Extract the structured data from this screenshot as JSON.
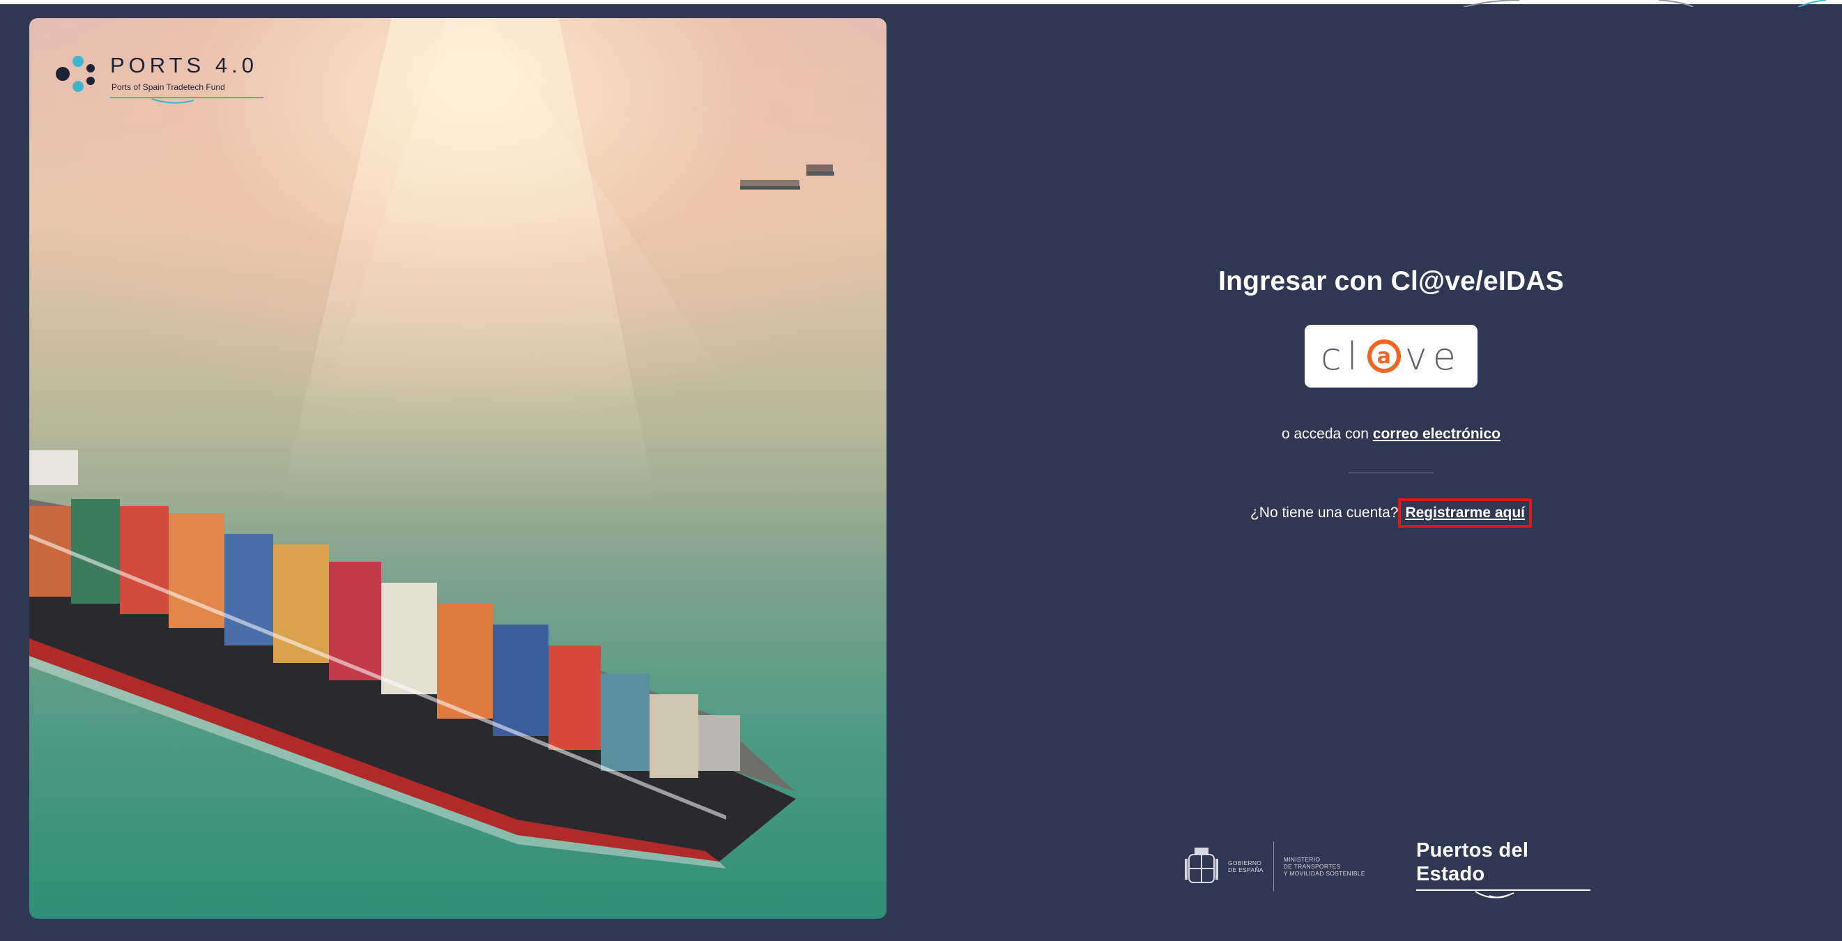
{
  "brand": {
    "ports_logo": "PORTS 4.0",
    "ports_tagline": "Ports of Spain Tradetech Fund",
    "colors": {
      "accent": "#f26522",
      "panel_bg": "#2f3853",
      "highlight": "#e3161b",
      "ports_teal": "#3fb6c8"
    }
  },
  "login": {
    "title": "Ingresar con Cl@ve/eIDAS",
    "clave_button_label": "cl@ve",
    "alt_prefix": "o acceda con",
    "alt_link": "correo electrónico",
    "register_prefix": "¿No tiene una cuenta?",
    "register_link": "Registrarme aquí"
  },
  "footer": {
    "gov_line1": "GOBIERNO",
    "gov_line2": "DE ESPAÑA",
    "ministry_line1": "MINISTERIO",
    "ministry_line2": "DE TRANSPORTES",
    "ministry_line3": "Y MOVILIDAD SOSTENIBLE",
    "puertos_label": "Puertos del Estado"
  },
  "icons": {
    "ports": "ports-logo-icon",
    "coat": "coat-of-arms-icon",
    "wave": "wave-icon"
  }
}
